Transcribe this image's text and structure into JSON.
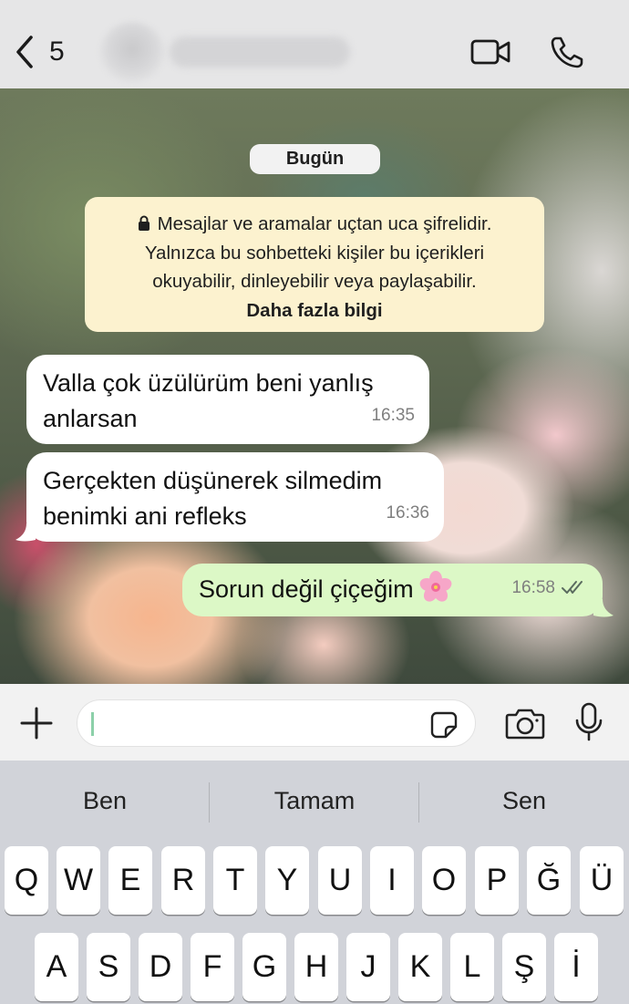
{
  "header": {
    "unread_count": "5",
    "icons": {
      "back": "chevron-left-icon",
      "video": "video-camera-icon",
      "call": "phone-icon"
    }
  },
  "chat": {
    "date_label": "Bugün",
    "encryption_notice": {
      "lines": [
        "Mesajlar ve aramalar uçtan uca şifrelidir.",
        "Yalnızca bu sohbetteki kişiler bu içerikleri",
        "okuyabilir, dinleyebilir veya paylaşabilir."
      ],
      "link": "Daha fazla bilgi"
    },
    "messages": [
      {
        "direction": "in",
        "lines": [
          "Valla çok üzülürüm beni yanlış",
          "anlarsan"
        ],
        "time": "16:35"
      },
      {
        "direction": "in",
        "lines": [
          "Gerçekten düşünerek silmedim",
          "benimki ani refleks"
        ],
        "time": "16:36"
      },
      {
        "direction": "out",
        "text": "Sorun değil çiçeğim",
        "emoji": "cherry-blossom",
        "time": "16:58",
        "status": "read"
      }
    ]
  },
  "input": {
    "value": "",
    "placeholder": ""
  },
  "suggestions": [
    "Ben",
    "Tamam",
    "Sen"
  ],
  "keyboard": {
    "row1": [
      "Q",
      "W",
      "E",
      "R",
      "T",
      "Y",
      "U",
      "I",
      "O",
      "P",
      "Ğ",
      "Ü"
    ],
    "row2": [
      "A",
      "S",
      "D",
      "F",
      "G",
      "H",
      "J",
      "K",
      "L",
      "Ş",
      "İ"
    ]
  },
  "colors": {
    "incoming_bubble": "#ffffff",
    "outgoing_bubble": "#dcf8c6",
    "system_notice": "#fcf2cf",
    "read_ticks": "#5a6b5f"
  }
}
